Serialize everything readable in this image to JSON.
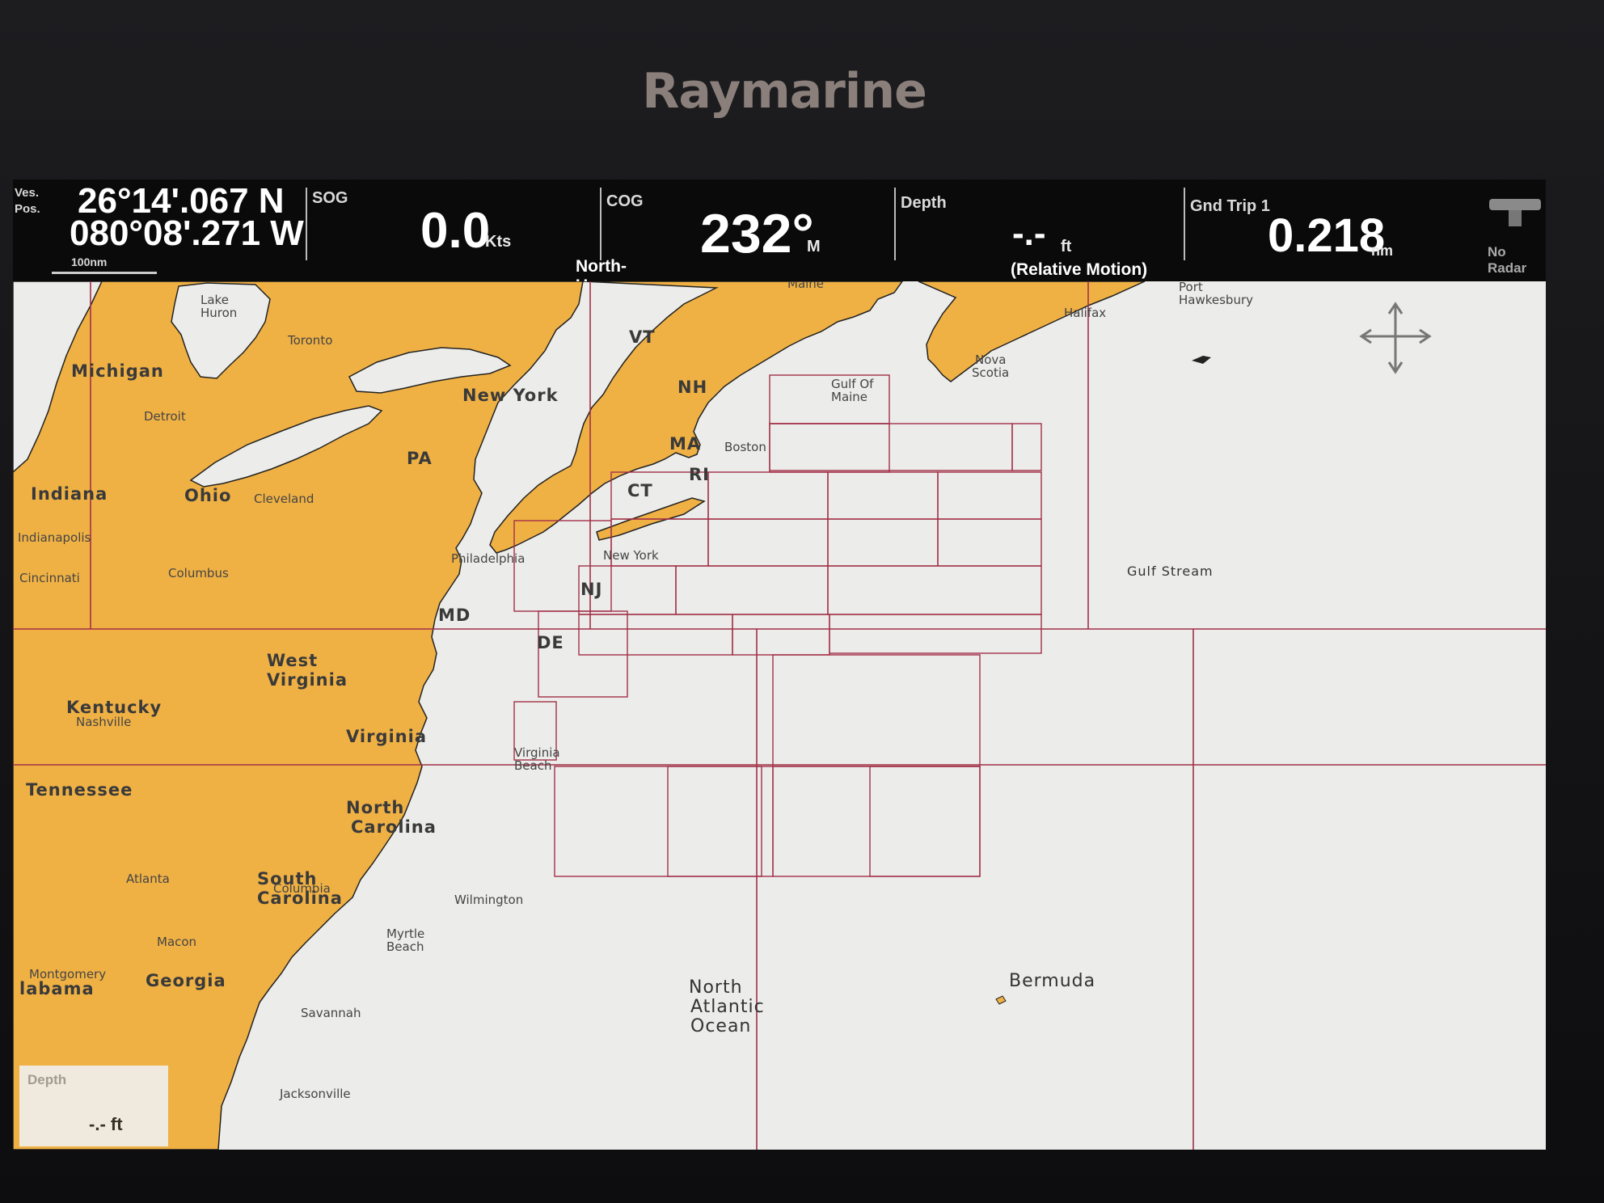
{
  "brand": "Raymarine",
  "position": {
    "label_top": "Ves.",
    "label_bottom": "Pos.",
    "lat": "26°14'.067 N",
    "lon": "080°08'.271 W",
    "scale": "100nm"
  },
  "sog": {
    "label": "SOG",
    "value": "0.0",
    "unit": "Kts"
  },
  "orientation": "North-Up",
  "cog": {
    "label": "COG",
    "value": "232°",
    "unit": "M"
  },
  "depth": {
    "label": "Depth",
    "value": "-.-",
    "unit": "ft",
    "mode": "(Relative Motion)"
  },
  "trip": {
    "label": "Gnd Trip 1",
    "value": "0.218",
    "unit": "nm"
  },
  "radar": {
    "label": "No Radar",
    "icon": "radar-icon"
  },
  "depth_panel": {
    "label": "Depth",
    "value": "-.- ft"
  },
  "map": {
    "land_color": "#f0b144",
    "sea_color": "#ececea",
    "grid_color": "#a23048",
    "states": [
      "Michigan",
      "Indiana",
      "Ohio",
      "New York",
      "PA",
      "VT",
      "NH",
      "MA",
      "RI",
      "CT",
      "NJ",
      "MD",
      "DE",
      "West",
      "Virginia",
      "Kentucky",
      "Virginia",
      "Tennessee",
      "North",
      "Carolina",
      "South",
      "Carolina",
      "Georgia",
      "labama"
    ],
    "cities": [
      "Lake",
      "Huron",
      "Toronto",
      "Detroit",
      "Cleveland",
      "Indianapolis",
      "Cincinnati",
      "Columbus",
      "Philadelphia",
      "Nashville",
      "Atlanta",
      "Columbia",
      "Macon",
      "Montgomery",
      "Wilmington",
      "Myrtle",
      "Beach",
      "Savannah",
      "Jacksonville",
      "Boston",
      "New York",
      "Virginia",
      "Beach",
      "Gulf Of",
      "Maine",
      "Nova",
      "Scotia",
      "Halifax",
      "Port",
      "Hawkesbury",
      "Maine"
    ],
    "features": [
      "Gulf Stream",
      "Bermuda",
      "North",
      "Atlantic",
      "Ocean"
    ]
  }
}
